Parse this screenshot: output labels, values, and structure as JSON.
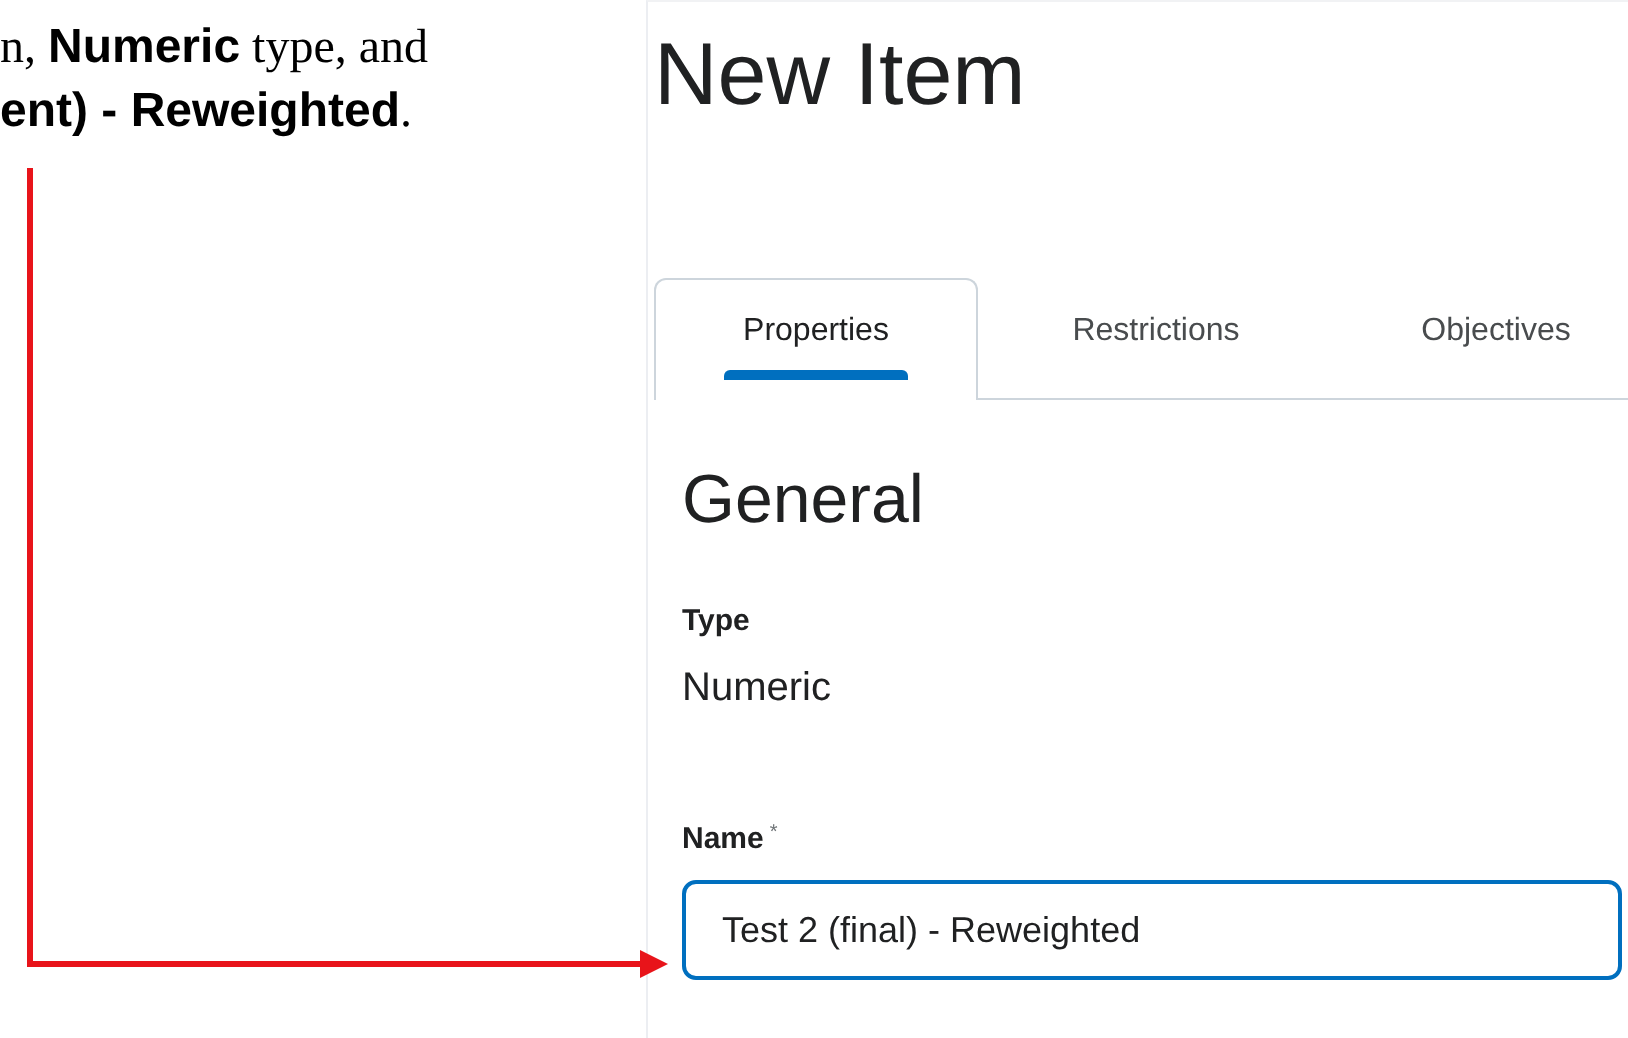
{
  "document": {
    "lines": [
      "n, **Numeric** type, and",
      "**ent) - Reweighted**."
    ]
  },
  "page": {
    "title": "New Item",
    "tabs": [
      {
        "label": "Properties",
        "selected": true
      },
      {
        "label": "Restrictions",
        "selected": false
      },
      {
        "label": "Objectives",
        "selected": false
      }
    ],
    "section_title": "General",
    "type_label": "Type",
    "type_value": "Numeric",
    "name_label": "Name",
    "required_mark": "*",
    "name_value": "Test 2 (final) - Reweighted"
  }
}
